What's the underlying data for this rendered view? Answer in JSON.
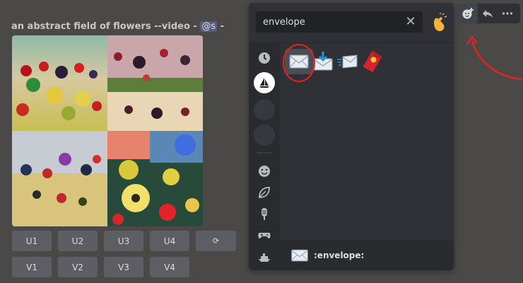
{
  "message": {
    "prompt": "an abstract field of flowers --video -",
    "mention": "@s",
    "trailing": " -"
  },
  "buttons": {
    "upscale": [
      "U1",
      "U2",
      "U3",
      "U4"
    ],
    "refresh_icon": "⟳",
    "variation": [
      "V1",
      "V2",
      "V3",
      "V4"
    ]
  },
  "picker": {
    "search_value": "envelope",
    "clear_icon": "✕",
    "skin_tone_icon": "clapping-hands-icon",
    "categories": [
      {
        "name": "recent-clock-icon"
      },
      {
        "name": "server-sailboat-icon"
      },
      {
        "name": "server-placeholder"
      },
      {
        "name": "server-placeholder"
      },
      {
        "name": "people-smiley-icon"
      },
      {
        "name": "nature-leaf-icon"
      },
      {
        "name": "food-popsicle-icon"
      },
      {
        "name": "activities-controller-icon"
      },
      {
        "name": "travel-boat-icon"
      }
    ],
    "results": [
      {
        "icon": "envelope-icon"
      },
      {
        "icon": "envelope-with-arrow-icon"
      },
      {
        "icon": "incoming-envelope-icon"
      },
      {
        "icon": "red-envelope-icon"
      }
    ],
    "footer_name": ":envelope:"
  },
  "colors": {
    "accent_red": "#e8221b",
    "picker_bg": "#2f3136",
    "button_bg": "#5c5e63"
  }
}
